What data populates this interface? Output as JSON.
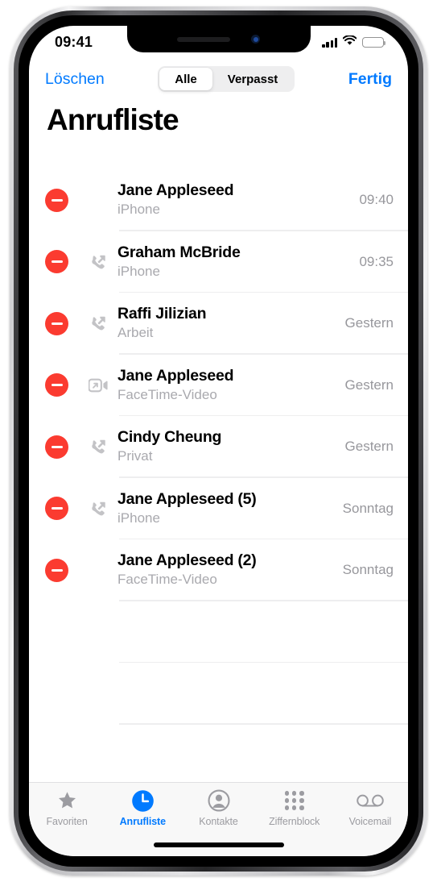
{
  "status_bar": {
    "time": "09:41",
    "signal_icon": "cellular-signal-icon",
    "wifi_icon": "wifi-icon",
    "battery_icon": "battery-icon"
  },
  "nav_bar": {
    "left_button": "Löschen",
    "right_button": "Fertig",
    "segments": [
      {
        "label": "Alle",
        "selected": true
      },
      {
        "label": "Verpasst",
        "selected": false
      }
    ]
  },
  "page": {
    "title": "Anrufliste"
  },
  "colors": {
    "accent_blue": "#007aff",
    "delete_red": "#fb3b30",
    "secondary_text": "#a9a9ae",
    "separator": "#eeeeef",
    "tab_inactive": "#9c9ca1"
  },
  "calls": [
    {
      "name": "Jane Appleseed",
      "label": "iPhone",
      "time": "09:40",
      "type_icon": null,
      "delete_icon": "minus-circle-icon"
    },
    {
      "name": "Graham McBride",
      "label": "iPhone",
      "time": "09:35",
      "type_icon": "outgoing-call-icon",
      "delete_icon": "minus-circle-icon"
    },
    {
      "name": "Raffi Jilizian",
      "label": "Arbeit",
      "time": "Gestern",
      "type_icon": "outgoing-call-icon",
      "delete_icon": "minus-circle-icon"
    },
    {
      "name": "Jane Appleseed",
      "label": "FaceTime-Video",
      "time": "Gestern",
      "type_icon": "outgoing-video-call-icon",
      "delete_icon": "minus-circle-icon"
    },
    {
      "name": "Cindy Cheung",
      "label": "Privat",
      "time": "Gestern",
      "type_icon": "outgoing-call-icon",
      "delete_icon": "minus-circle-icon"
    },
    {
      "name": "Jane Appleseed (5)",
      "label": "iPhone",
      "time": "Sonntag",
      "type_icon": "outgoing-call-icon",
      "delete_icon": "minus-circle-icon"
    },
    {
      "name": "Jane Appleseed (2)",
      "label": "FaceTime-Video",
      "time": "Sonntag",
      "type_icon": null,
      "delete_icon": "minus-circle-icon"
    }
  ],
  "empty_rows": 3,
  "tab_bar": {
    "items": [
      {
        "label": "Favoriten",
        "icon": "star-icon",
        "active": false
      },
      {
        "label": "Anrufliste",
        "icon": "clock-icon",
        "active": true
      },
      {
        "label": "Kontakte",
        "icon": "person-circle-icon",
        "active": false
      },
      {
        "label": "Ziffernblock",
        "icon": "keypad-icon",
        "active": false
      },
      {
        "label": "Voicemail",
        "icon": "voicemail-icon",
        "active": false
      }
    ]
  }
}
